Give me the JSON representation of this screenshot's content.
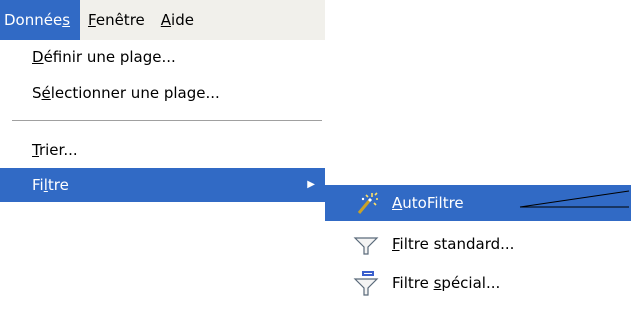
{
  "menubar": {
    "items": [
      {
        "label_pre": "Donnée",
        "label_u": "s",
        "label_post": ""
      },
      {
        "label_pre": "",
        "label_u": "F",
        "label_post": "enêtre"
      },
      {
        "label_pre": "",
        "label_u": "A",
        "label_post": "ide"
      }
    ]
  },
  "menu": {
    "define_range": {
      "u": "D",
      "rest": "éfinir une plage..."
    },
    "select_range": {
      "pre": "S",
      "u": "é",
      "rest": "lectionner une plage..."
    },
    "sort": {
      "u": "T",
      "rest": "rier..."
    },
    "filter": {
      "pre": "Fi",
      "u": "l",
      "rest": "tre",
      "arrow": "▶"
    }
  },
  "submenu": {
    "autofilter": {
      "u": "A",
      "rest": "utoFiltre",
      "icon": "autofilter-wand-icon"
    },
    "standard_filter": {
      "u": "F",
      "rest": "iltre standard...",
      "icon": "funnel-icon"
    },
    "special_filter": {
      "pre": "Filtre ",
      "u": "s",
      "rest": "pécial...",
      "icon": "funnel-special-icon"
    }
  },
  "colors": {
    "highlight": "#316ac5",
    "menubar_bg": "#f1f0eb",
    "separator": "#a0a0a0"
  }
}
